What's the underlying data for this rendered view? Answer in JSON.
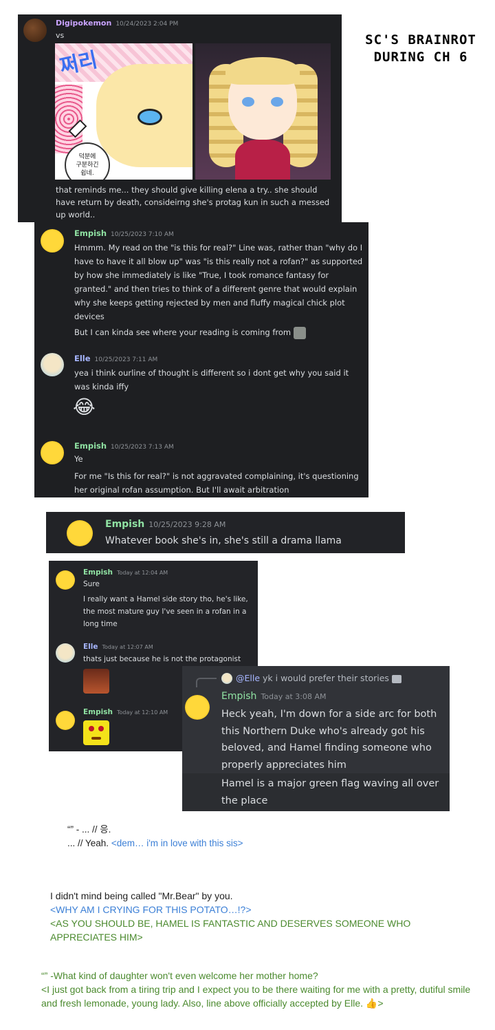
{
  "title": {
    "line1": "SC'S BRAINROT",
    "line2": "DURING CH 6"
  },
  "panel1": {
    "user": "Digipokemon",
    "time": "10/24/2023 2:04 PM",
    "first_line": "vs",
    "manga_text": "덕분에\n구분하긴\n쉽네.",
    "sfx": "쩌리",
    "text": "that reminds me... they should give killing elena a try.. she should have return by death, consideirng she's protag kun in such a messed up world.."
  },
  "panel2": {
    "msg1": {
      "user": "Empish",
      "time": "10/25/2023 7:10 AM",
      "text": "Hmmm. My read on the \"is this for real?\" Line was, rather than \"why do I have to have it all blow up\" was \"is this really not a rofan?\" as supported by how she immediately is like \"True, I took romance fantasy for granted.\" and then tries to think of a different genre that would explain why she keeps getting rejected by men and fluffy magical chick plot devices",
      "text2": "But I can kinda see where your reading is coming from"
    },
    "msg2": {
      "user": "Elle",
      "time": "10/25/2023 7:11 AM",
      "text": "yea i think ourline of thought is different so i dont get why you said it was kinda iffy",
      "emoji": "😂"
    },
    "msg3": {
      "user": "Empish",
      "time": "10/25/2023 7:13 AM",
      "text": "Ye",
      "text2": "For me \"Is this for real?\" is not aggravated complaining, it's questioning her original rofan assumption. But I'll await arbitration"
    }
  },
  "panel3": {
    "user": "Empish",
    "time": "10/25/2023 9:28 AM",
    "text": "Whatever book she's in, she's still a drama llama"
  },
  "panel4": {
    "msg1": {
      "user": "Empish",
      "time": "Today at 12:04 AM",
      "text": "Sure",
      "text2": "I really want a Hamel side story tho, he's like, the most mature guy I've seen in a rofan in a long time"
    },
    "msg2": {
      "user": "Elle",
      "time": "Today at 12:07 AM",
      "text": "thats just because he is not the protagonist"
    },
    "msg3": {
      "user": "Empish",
      "time": "Today at 12:10 AM"
    }
  },
  "panel5": {
    "reply_user": "@Elle",
    "reply_text": "yk i would prefer their stories",
    "user": "Empish",
    "time": "Today at 3:08 AM",
    "text": "Heck yeah, I'm down for a side arc for both this Northern Duke who's already got his beloved, and Hamel finding someone who properly appreciates him",
    "text2": "Hamel is a major green flag waving all over the place"
  },
  "notes": {
    "n1_line1": "“” - ... // 응.",
    "n1_line2a": "... // Yeah. ",
    "n1_line2b": "<dem… i'm in love with this sis>",
    "n2_line1": "I didn't mind being called \"Mr.Bear\" by you.",
    "n2_line2": "<WHY AM I CRYING FOR THIS POTATO…!?>",
    "n2_line3": "<AS YOU SHOULD BE, HAMEL IS FANTASTIC AND DESERVES SOMEONE WHO APPRECIATES HIM>",
    "n3_line1": "“” -What kind of daughter won't even welcome her mother home?",
    "n3_line2": "<I just got back from a tiring trip and I expect you to be there waiting for me with a pretty, dutiful smile and fresh lemonade, young lady. Also, line above officially accepted by Elle. 👍>"
  },
  "colors": {
    "panel_bg": "#1e1f22",
    "empish": "#8fe1a2",
    "elle": "#a7b6ff",
    "blue_note": "#3b7fd6",
    "green_note": "#4b8a2e"
  }
}
